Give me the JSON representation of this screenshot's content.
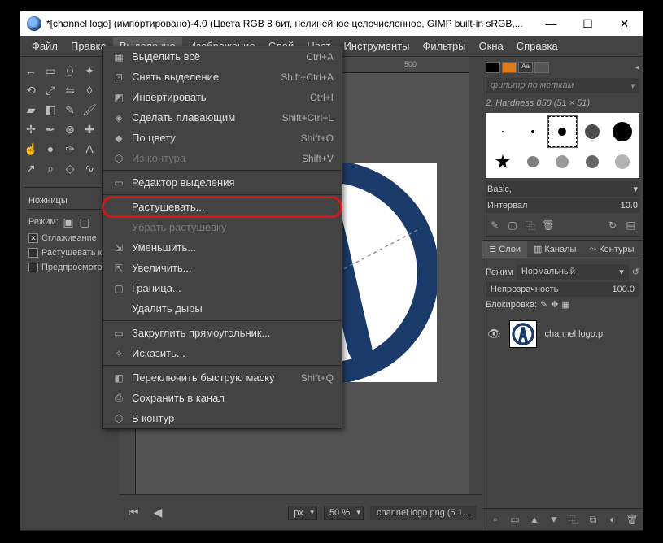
{
  "title": "*[channel logo] (импортировано)-4.0 (Цвета RGB 8 бит, нелинейное целочисленное, GIMP built-in sRGB,...",
  "menu": {
    "items": [
      "Файл",
      "Правка",
      "Выделение",
      "Изображение",
      "Слой",
      "Цвет",
      "Инструменты",
      "Фильтры",
      "Окна",
      "Справка"
    ],
    "active_index": 2
  },
  "dropdown": [
    {
      "icon": "▦",
      "label": "Выделить всё",
      "shortcut": "Ctrl+A"
    },
    {
      "icon": "⊡",
      "label": "Снять выделение",
      "shortcut": "Shift+Ctrl+A"
    },
    {
      "icon": "◩",
      "label": "Инвертировать",
      "shortcut": "Ctrl+I"
    },
    {
      "icon": "◈",
      "label": "Сделать плавающим",
      "shortcut": "Shift+Ctrl+L"
    },
    {
      "icon": "◆",
      "label": "По цвету",
      "shortcut": "Shift+O"
    },
    {
      "icon": "⬡",
      "label": "Из контура",
      "shortcut": "Shift+V",
      "disabled": true
    },
    {
      "sep": true
    },
    {
      "icon": "▭",
      "label": "Редактор выделения"
    },
    {
      "sep": true
    },
    {
      "icon": "",
      "label": "Растушевать...",
      "highlight": true
    },
    {
      "icon": "",
      "label": "Убрать растушёвку",
      "disabled": true
    },
    {
      "icon": "⇲",
      "label": "Уменьшить..."
    },
    {
      "icon": "⇱",
      "label": "Увеличить..."
    },
    {
      "icon": "▢",
      "label": "Граница..."
    },
    {
      "icon": "",
      "label": "Удалить дыры"
    },
    {
      "sep": true
    },
    {
      "icon": "▭",
      "label": "Закруглить прямоугольник..."
    },
    {
      "icon": "✧",
      "label": "Исказить..."
    },
    {
      "sep": true
    },
    {
      "icon": "◧",
      "label": "Переключить быструю маску",
      "shortcut": "Shift+Q"
    },
    {
      "icon": "⎙",
      "label": "Сохранить в канал"
    },
    {
      "icon": "⬡",
      "label": "В контур"
    }
  ],
  "toolbox": {
    "options_title": "Ножницы",
    "mode_label": "Режим:",
    "opt_antialias": "Сглаживание",
    "opt_feather": "Растушевать к",
    "opt_preview": "Предпросмотр"
  },
  "ruler": {
    "mark_500": "500"
  },
  "rightpanel": {
    "filter_placeholder": "фильтр по меткам",
    "brush_name": "2. Hardness 050 (51 × 51)",
    "basic_label": "Basic,",
    "interval_label": "Интервал",
    "interval_value": "10.0",
    "tabs": {
      "layers": "Слои",
      "channels": "Каналы",
      "paths": "Контуры"
    },
    "mode_label": "Режим",
    "mode_value": "Нормальный",
    "opacity_label": "Непрозрачность",
    "opacity_value": "100.0",
    "lock_label": "Блокировка:",
    "layer_name": "channel logo.p"
  },
  "statusbar": {
    "unit": "px",
    "zoom": "50 %",
    "file": "channel logo.png (5.1..."
  },
  "winbtns": {
    "min": "—",
    "max": "☐",
    "close": "✕"
  }
}
